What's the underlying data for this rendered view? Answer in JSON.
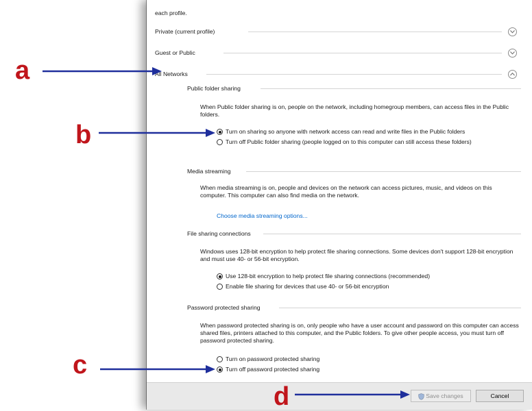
{
  "intro_text": "each profile.",
  "profiles": [
    {
      "label": "Private (current profile)",
      "expanded": false
    },
    {
      "label": "Guest or Public",
      "expanded": false
    },
    {
      "label": "All Networks",
      "expanded": true
    }
  ],
  "sections": {
    "public_folder": {
      "heading": "Public folder sharing",
      "description": "When Public folder sharing is on, people on the network, including homegroup members, can access files in the Public folders.",
      "options": [
        {
          "label": "Turn on sharing so anyone with network access can read and write files in the Public folders",
          "selected": true
        },
        {
          "label": "Turn off Public folder sharing (people logged on to this computer can still access these folders)",
          "selected": false
        }
      ]
    },
    "media": {
      "heading": "Media streaming",
      "description": "When media streaming is on, people and devices on the network can access pictures, music, and videos on this computer. This computer can also find media on the network.",
      "link": "Choose media streaming options..."
    },
    "file_sharing": {
      "heading": "File sharing connections",
      "description": "Windows uses 128-bit encryption to help protect file sharing connections. Some devices don't support 128-bit encryption and must use 40- or 56-bit encryption.",
      "options": [
        {
          "label": "Use 128-bit encryption to help protect file sharing connections (recommended)",
          "selected": true
        },
        {
          "label": "Enable file sharing for devices that use 40- or 56-bit encryption",
          "selected": false
        }
      ]
    },
    "password": {
      "heading": "Password protected sharing",
      "description": "When password protected sharing is on, only people who have a user account and password on this computer can access shared files, printers attached to this computer, and the Public folders. To give other people access, you must turn off password protected sharing.",
      "options": [
        {
          "label": "Turn on password protected sharing",
          "selected": false
        },
        {
          "label": "Turn off password protected sharing",
          "selected": true
        }
      ]
    }
  },
  "footer": {
    "save_label": "Save changes",
    "save_enabled": false,
    "cancel_label": "Cancel"
  },
  "annotations": {
    "a": "a",
    "b": "b",
    "c": "c",
    "d": "d"
  },
  "colors": {
    "annotation_letter": "#c0151b",
    "annotation_arrow": "#1f2f9c",
    "link": "#0066cc"
  },
  "icons": {
    "collapsed": "chevron-down-icon",
    "expanded": "chevron-up-icon",
    "save": "shield-icon"
  }
}
